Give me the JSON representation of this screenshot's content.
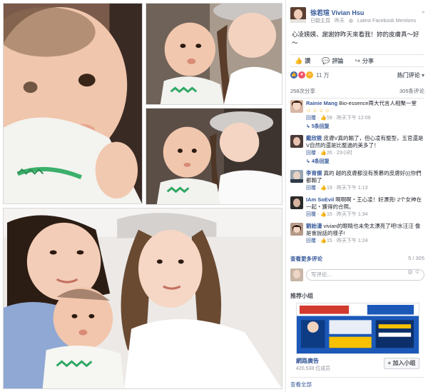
{
  "post": {
    "author": "徐若瑄 Vivian Hsu",
    "meta": {
      "status": "已驗主頁",
      "date": "昨天",
      "source": "Latest Facebook Mentions"
    },
    "caption": "心凌姨姨、謝謝妳昨天來看我！妳的皮膚真～好～"
  },
  "actions": {
    "like": "讚",
    "comment": "評論",
    "share": "分享"
  },
  "reactions": {
    "count": "11 万",
    "sort_label": "热门评论"
  },
  "stats": {
    "shares": "258次分享",
    "comments": "305条评论"
  },
  "comments": [
    {
      "name": "Rainie Mang",
      "text": "Bio-essence兩大代言人相聚一堂",
      "has_emoji_row": true,
      "like_label": "回覆",
      "likes": "59",
      "time": "昨天下午 12:09",
      "replies": "5条回复"
    },
    {
      "name": "戴欣筱",
      "text": "皮膚V真的輸了，但心凌有整型，五官還是V自然的還是比整過的美多了！",
      "has_emoji_row": false,
      "like_label": "回覆",
      "likes": "26",
      "time": "23小时",
      "replies": "4条回复"
    },
    {
      "name": "李育傑",
      "text": "真的 越的皮膚都沒有羨慕的皮膚好(((你們都輸了",
      "has_emoji_row": false,
      "like_label": "回覆",
      "likes": "19",
      "time": "昨天下午 1:13",
      "replies": ""
    },
    {
      "name": "IAm SoEvil",
      "text": "啊啊啊・王心凌！好漂亮! 2个女神在一起・獲得的合照。",
      "has_emoji_row": false,
      "like_label": "回覆",
      "likes": "15",
      "time": "昨天下午 1:34",
      "replies": ""
    },
    {
      "name": "劉詒濠",
      "text": "vivian的眼睛也未免太漂亮了吧!水汪汪 像是會說話的樣子!",
      "has_emoji_row": false,
      "like_label": "回覆",
      "likes": "15",
      "time": "昨天下午 1:24",
      "replies": ""
    }
  ],
  "more_comments": {
    "label": "查看更多评论",
    "count": "5 / 305"
  },
  "write_comment": {
    "placeholder": "写评论..."
  },
  "groups": {
    "heading": "推荐小组",
    "ad_name": "網路廣告",
    "members": "420,538 位成员",
    "join_label": "+ 加入小组",
    "see_all": "查看全部"
  },
  "colors": {
    "link": "#365899",
    "like_blue": "#4267b2",
    "love_red": "#f25268",
    "haha_yellow": "#f7b125"
  }
}
